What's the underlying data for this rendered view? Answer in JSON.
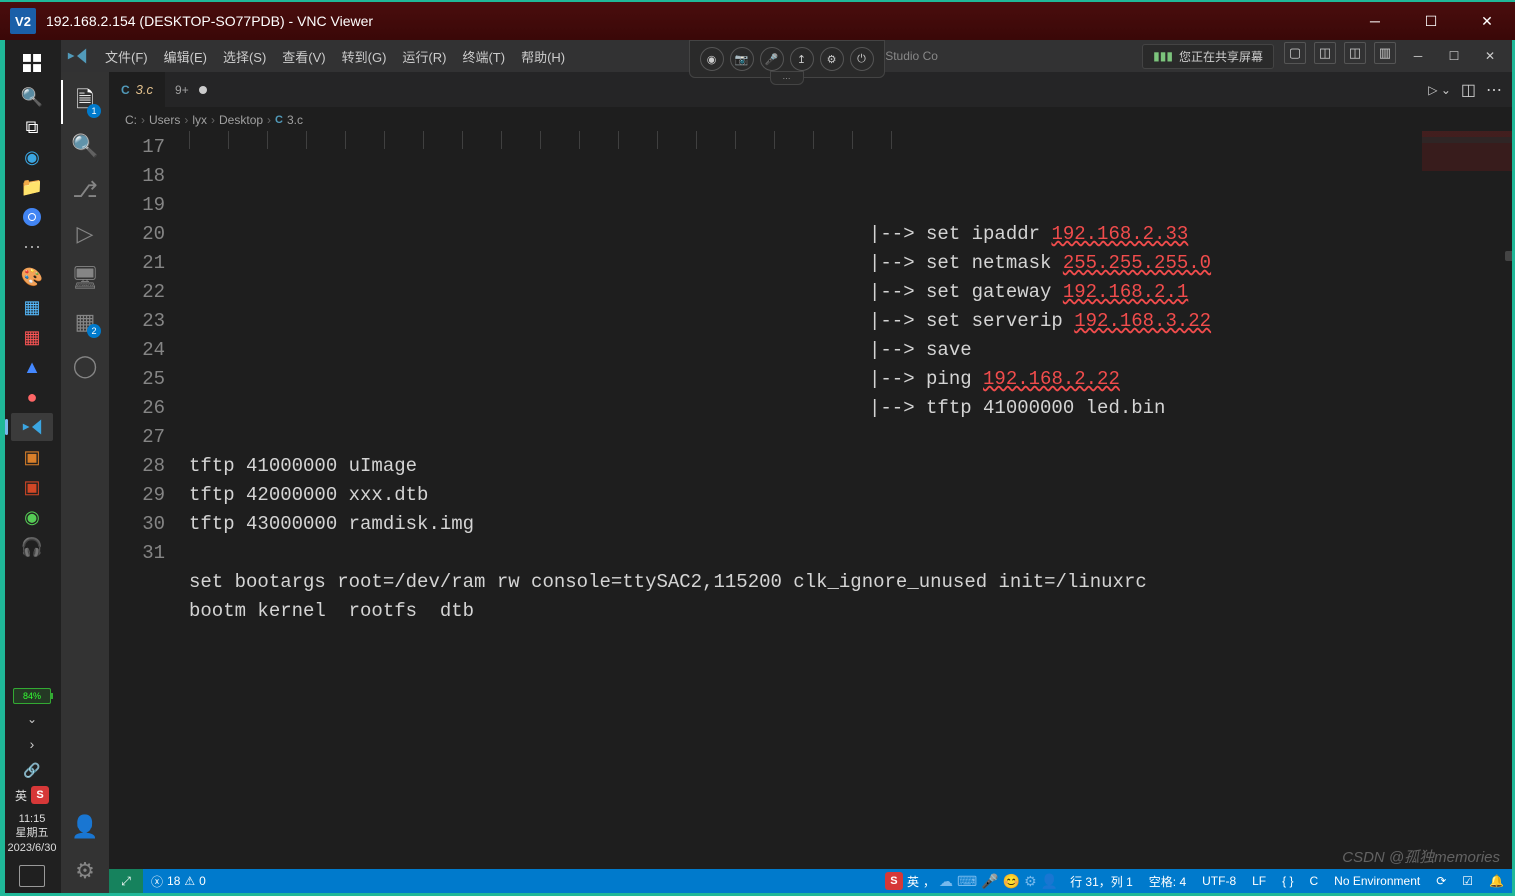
{
  "vnc": {
    "logo": "V2",
    "title": "192.168.2.154 (DESKTOP-SO77PDB) - VNC Viewer"
  },
  "taskbar": {
    "battery": "84%",
    "ime": "英",
    "clock": {
      "time": "11:15",
      "day": "星期五",
      "date": "2023/6/30"
    }
  },
  "menubar": {
    "items": [
      "文件(F)",
      "编辑(E)",
      "选择(S)",
      "查看(V)",
      "转到(G)",
      "运行(R)",
      "终端(T)",
      "帮助(H)"
    ],
    "centerHint": "3.c - Visual Studio Co",
    "share": "您正在共享屏幕"
  },
  "tab": {
    "name": "3.c",
    "meta": "9+"
  },
  "breadcrumb": [
    "C:",
    "Users",
    "lyx",
    "Desktop",
    "3.c"
  ],
  "code": {
    "startLine": 17,
    "lines": [
      {
        "n": 17,
        "pad": true,
        "text": "|--> set ipaddr ",
        "err": "192.168.2.33"
      },
      {
        "n": 18,
        "pad": true,
        "text": "|--> set netmask ",
        "err": "255.255.255.0"
      },
      {
        "n": 19,
        "pad": true,
        "text": "|--> set gateway ",
        "err": "192.168.2.1"
      },
      {
        "n": 20,
        "pad": true,
        "text": "|--> set serverip ",
        "err": "192.168.3.22"
      },
      {
        "n": 21,
        "pad": true,
        "text": "|--> save"
      },
      {
        "n": 22,
        "pad": true,
        "text": "|--> ping ",
        "err": "192.168.2.22"
      },
      {
        "n": 23,
        "pad": true,
        "text": "|--> tftp 41000000 led.bin"
      },
      {
        "n": 24,
        "text": ""
      },
      {
        "n": 25,
        "text": "tftp 41000000 uImage"
      },
      {
        "n": 26,
        "text": "tftp 42000000 xxx.dtb"
      },
      {
        "n": 27,
        "text": "tftp 43000000 ramdisk.img"
      },
      {
        "n": 28,
        "text": ""
      },
      {
        "n": 29,
        "text": "set bootargs root=/dev/ram rw console=ttySAC2,115200 clk_ignore_unused init=/linuxrc"
      },
      {
        "n": 30,
        "text": "bootm kernel  rootfs  dtb"
      },
      {
        "n": 31,
        "text": ""
      }
    ]
  },
  "statusbar": {
    "errors": "18",
    "warnings": "0",
    "sogouLabel": "英",
    "pos": "行 31，列 1",
    "spaces": "空格: 4",
    "encoding": "UTF-8",
    "eol": "LF",
    "braces": "{ }",
    "lang": "C",
    "env": "No Environment"
  },
  "watermark": "CSDN @孤独memories"
}
